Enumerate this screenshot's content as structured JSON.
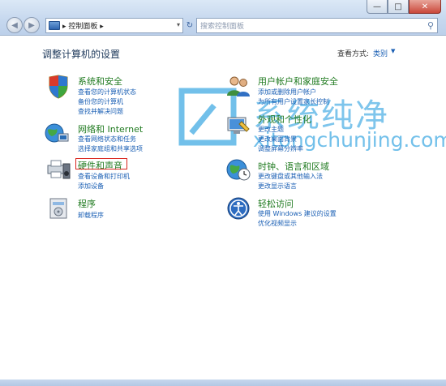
{
  "window": {
    "minimize": "—",
    "maximize": "□",
    "close": "✕"
  },
  "toolbar": {
    "back_glyph": "◀",
    "forward_glyph": "▶",
    "address_path": "▸ 控制面板 ▸",
    "address_dropdown": "▾",
    "refresh_glyph": "↻",
    "search_placeholder": "搜索控制面板",
    "search_icon": "search-icon"
  },
  "main": {
    "title": "调整计算机的设置",
    "view_by_label": "查看方式:",
    "view_by_value": "类别",
    "view_by_arrow": "▼"
  },
  "categories_left": [
    {
      "icon": "shield-icon",
      "title": "系统和安全",
      "links": [
        "查看您的计算机状态",
        "备份您的计算机",
        "查找并解决问题"
      ]
    },
    {
      "icon": "network-globe-icon",
      "title": "网络和 Internet",
      "links": [
        "查看网络状态和任务",
        "选择家庭组和共享选项"
      ]
    },
    {
      "icon": "printer-speaker-icon",
      "title": "硬件和声音",
      "links": [
        "查看设备和打印机",
        "添加设备"
      ]
    },
    {
      "icon": "programs-icon",
      "title": "程序",
      "links": [
        "卸载程序"
      ]
    }
  ],
  "categories_right": [
    {
      "icon": "users-icon",
      "title": "用户帐户和家庭安全",
      "links": [
        "添加或删除用户帐户",
        "为所有用户设置家长控制"
      ]
    },
    {
      "icon": "appearance-icon",
      "title": "外观和个性化",
      "links": [
        "更改主题",
        "更改桌面背景",
        "调整屏幕分辨率"
      ]
    },
    {
      "icon": "clock-globe-icon",
      "title": "时钟、语言和区域",
      "links": [
        "更改键盘或其他输入法",
        "更改显示语言"
      ]
    },
    {
      "icon": "ease-of-access-icon",
      "title": "轻松访问",
      "links": [
        "使用 Windows 建议的设置",
        "优化视频显示"
      ]
    }
  ],
  "watermark": {
    "chinese": "系统纯净",
    "url": "xitongchunjing.com"
  },
  "colors": {
    "category_title": "#1f7a1f",
    "link": "#1a5fb4",
    "highlight_border": "#d9241c",
    "watermark": "#1496dc"
  }
}
